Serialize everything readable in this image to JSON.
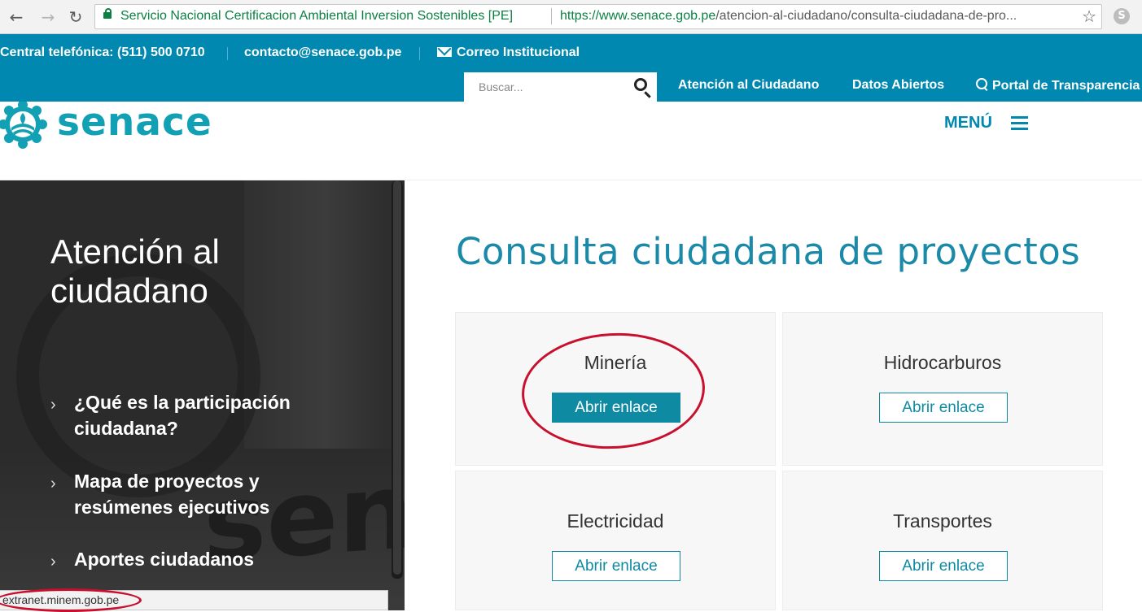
{
  "browser": {
    "cert_name": "Servicio Nacional Certificacion Ambiental Inversion Sostenibles [PE]",
    "url_host": "https://www.senace.gob.pe",
    "url_path": "/atencion-al-ciudadano/consulta-ciudadana-de-pro...",
    "status_url": "extranet.minem.gob.pe"
  },
  "topbar": {
    "phone": "Central telefónica: (511) 500 0710",
    "email": "contacto@senace.gob.pe",
    "mail_link": "Correo Institucional",
    "search_placeholder": "Buscar...",
    "links": [
      "Atención al Ciudadano",
      "Datos Abiertos",
      "Portal de Transparencia"
    ]
  },
  "header": {
    "logo_text": "senace",
    "menu_label": "MENÚ"
  },
  "sidebar": {
    "title": "Atención al ciudadano",
    "items": [
      {
        "label": "¿Qué es la participación ciudadana?"
      },
      {
        "label": "Mapa de proyectos y resúmenes ejecutivos"
      },
      {
        "label": "Aportes ciudadanos"
      }
    ]
  },
  "main": {
    "title": "Consulta ciudadana de proyectos",
    "cards": [
      {
        "title": "Minería",
        "button": "Abrir enlace"
      },
      {
        "title": "Hidrocarburos",
        "button": "Abrir enlace"
      },
      {
        "title": "Electricidad",
        "button": "Abrir enlace"
      },
      {
        "title": "Transportes",
        "button": "Abrir enlace"
      }
    ]
  },
  "colors": {
    "topbar_bg": "#0088b0",
    "brand_teal": "#12a0b4",
    "button": "#0f8aa3",
    "sidebar_bg": "#2b2b2b",
    "annotation": "#c8102e"
  },
  "icons": {
    "back": "arrow-left-icon",
    "forward": "arrow-right-icon",
    "reload": "reload-icon",
    "lock": "lock-icon",
    "bookmark": "star-icon",
    "extension": "skype-icon",
    "mail": "envelope-icon",
    "search": "search-icon",
    "transparency": "magnifier-icon",
    "menu": "hamburger-icon",
    "list": "chevron-right-icon"
  }
}
